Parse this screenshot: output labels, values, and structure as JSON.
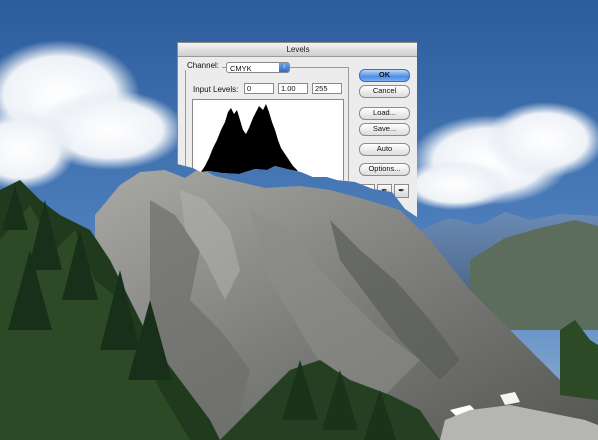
{
  "dialog": {
    "title": "Levels",
    "channel_label": "Channel:",
    "channel_value": "CMYK",
    "input_levels_label": "Input Levels:",
    "input_levels": [
      "0",
      "1.00",
      "255"
    ]
  },
  "buttons": {
    "ok": "OK",
    "cancel": "Cancel",
    "load": "Load...",
    "save": "Save...",
    "auto": "Auto",
    "options": "Options..."
  },
  "icons": {
    "select_arrows": "up-down-arrows",
    "eyedroppers": [
      "black-point-eyedropper",
      "gray-point-eyedropper",
      "white-point-eyedropper"
    ]
  },
  "colors": {
    "sky_top": "#2f5f9e",
    "sky_bottom": "#6b9bd0",
    "accent": "#4f8ee6"
  }
}
